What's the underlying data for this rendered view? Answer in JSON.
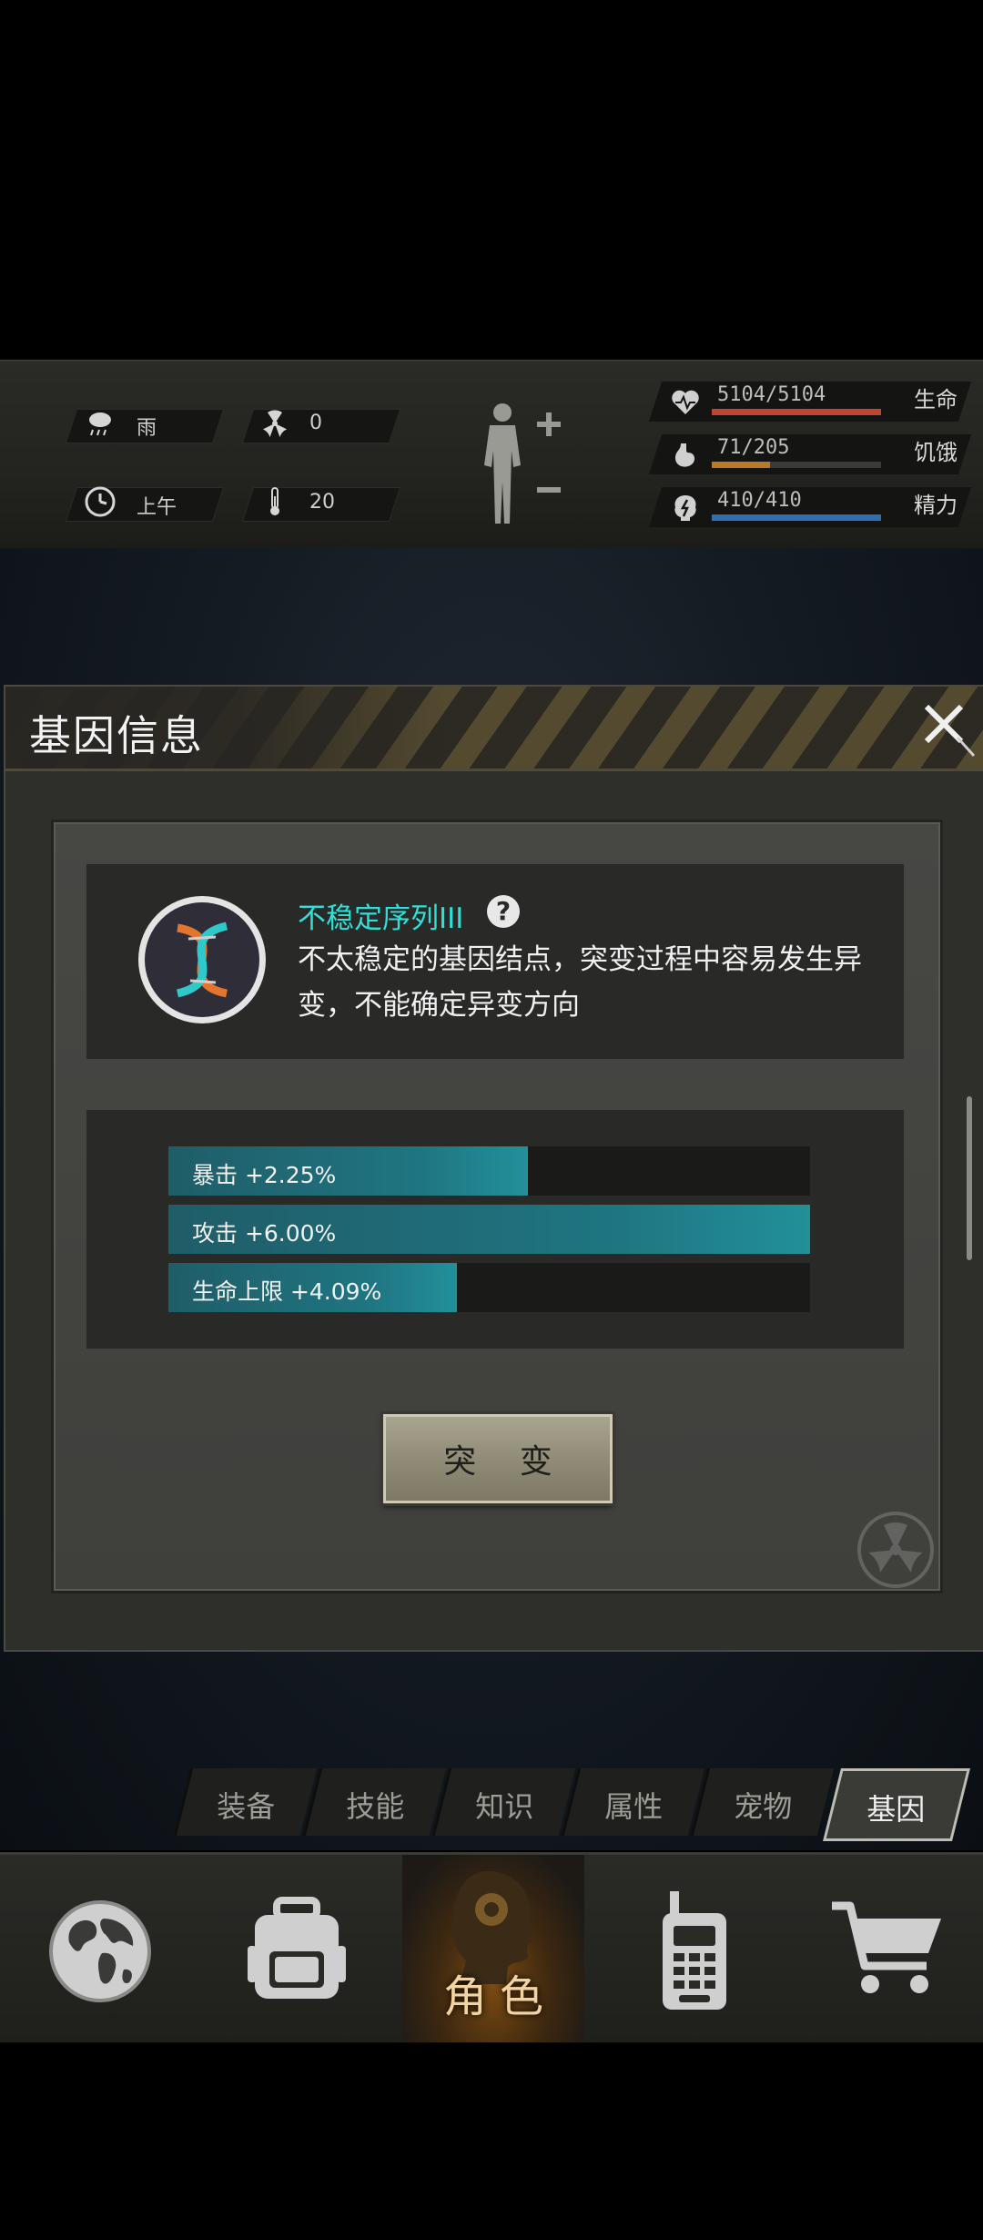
{
  "status": {
    "weather": {
      "icon": "rain-cloud-icon",
      "label": "雨"
    },
    "radiation": {
      "icon": "radiation-icon",
      "value": "0"
    },
    "time": {
      "icon": "clock-icon",
      "label": "上午"
    },
    "temperature": {
      "icon": "thermometer-icon",
      "value": "20"
    },
    "resources": [
      {
        "key": "life",
        "icon": "heart-icon",
        "value": "5104/5104",
        "label": "生命",
        "fraction": 1.0,
        "color": "#c4452f"
      },
      {
        "key": "hunger",
        "icon": "stomach-icon",
        "value": "71/205",
        "label": "饥饿",
        "fraction": 0.346,
        "color": "#b7792a"
      },
      {
        "key": "energy",
        "icon": "brain-icon",
        "value": "410/410",
        "label": "精力",
        "fraction": 1.0,
        "color": "#2f6fb0"
      }
    ]
  },
  "dialog": {
    "title": "基因信息",
    "gene": {
      "name": "不稳定序列III",
      "help": "?",
      "description": "不太稳定的基因结点，突变过程中容易发生异变，不能确定异变方向"
    },
    "bonuses": [
      {
        "label": "暴击 +2.25%",
        "fraction": 0.56
      },
      {
        "label": "攻击 +6.00%",
        "fraction": 1.0
      },
      {
        "label": "生命上限 +4.09%",
        "fraction": 0.45
      }
    ],
    "mutate_button": "突 变"
  },
  "tabs": [
    {
      "label": "装备",
      "active": false
    },
    {
      "label": "技能",
      "active": false
    },
    {
      "label": "知识",
      "active": false
    },
    {
      "label": "属性",
      "active": false
    },
    {
      "label": "宠物",
      "active": false
    },
    {
      "label": "基因",
      "active": true
    }
  ],
  "nav": {
    "world": {
      "icon": "globe-icon"
    },
    "backpack": {
      "icon": "backpack-icon"
    },
    "role": {
      "icon": "head-silhouette-icon",
      "label": "角色"
    },
    "radio": {
      "icon": "walkie-talkie-icon"
    },
    "shop": {
      "icon": "shopping-cart-icon"
    }
  }
}
